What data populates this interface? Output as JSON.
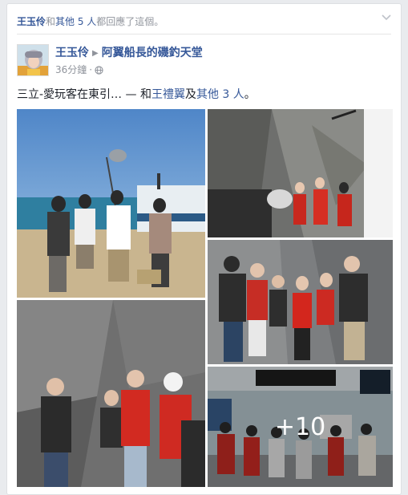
{
  "activity": {
    "lead_name": "王玉伶",
    "connector": "和",
    "others_link": "其他 5 人",
    "suffix": "都回應了這個。"
  },
  "post": {
    "author": "王玉伶",
    "group": "阿翼船長的磯釣天堂",
    "timestamp": "36分鐘",
    "separator": "·",
    "privacy_icon": "globe-icon",
    "text": "三立-愛玩客在東引… — 和",
    "tagged": "王禮翼",
    "conj": "及",
    "others": "其他 3 人",
    "end": "。"
  },
  "photos": {
    "more_count": "+10"
  },
  "colors": {
    "link": "#365899",
    "muted": "#90949c",
    "text": "#1d2129",
    "background": "#e9ebee"
  }
}
